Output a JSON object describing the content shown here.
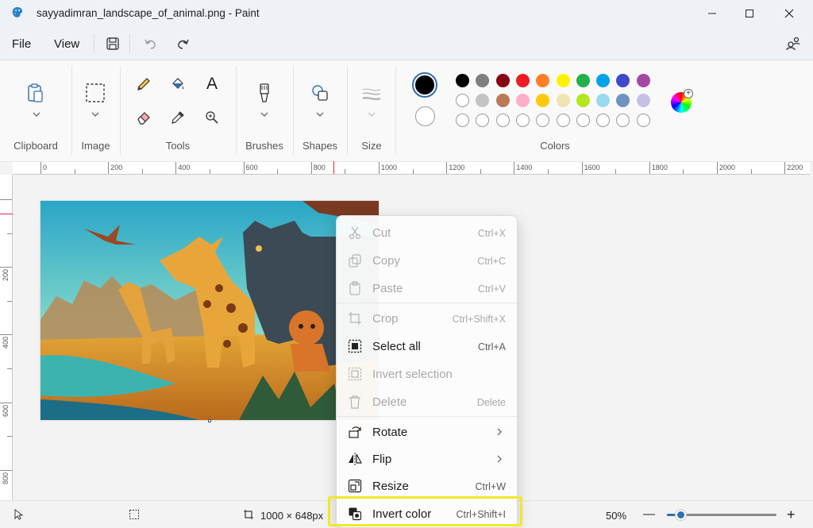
{
  "window": {
    "title": "sayyadimran_landscape_of_animal.png - Paint",
    "minimize_icon": "minimize-icon",
    "maximize_icon": "maximize-icon",
    "close_icon": "close-icon"
  },
  "menubar": {
    "file_label": "File",
    "view_label": "View",
    "save_icon": "save-icon",
    "undo_icon": "undo-icon",
    "redo_icon": "redo-icon",
    "account_icon": "account-icon"
  },
  "ribbon": {
    "clipboard_label": "Clipboard",
    "image_label": "Image",
    "tools_label": "Tools",
    "brushes_label": "Brushes",
    "shapes_label": "Shapes",
    "size_label": "Size",
    "colors_label": "Colors",
    "text_tool_glyph": "A",
    "primary_color": "#000000",
    "secondary_color": "#ffffff",
    "palette_row1": [
      "#000000",
      "#7f7f7f",
      "#880015",
      "#ed1c24",
      "#ff7f27",
      "#fff200",
      "#22b14c",
      "#00a2e8",
      "#3f48cc",
      "#a349a4"
    ],
    "palette_row2": [
      "#ffffff",
      "#c3c3c3",
      "#b97a57",
      "#ffaec9",
      "#ffc90e",
      "#efe4b0",
      "#b5e61d",
      "#99d9ea",
      "#7092be",
      "#c8bfe7"
    ]
  },
  "ruler": {
    "h_ticks": [
      "0",
      "200",
      "400",
      "600",
      "800",
      "1000",
      "1200",
      "1400",
      "1600",
      "1800",
      "2000",
      "2200"
    ],
    "v_ticks": [
      "200",
      "400",
      "600",
      "800"
    ]
  },
  "context_menu": {
    "items": [
      {
        "label": "Cut",
        "shortcut": "Ctrl+X",
        "icon": "scissors-icon",
        "enabled": false
      },
      {
        "label": "Copy",
        "shortcut": "Ctrl+C",
        "icon": "copy-icon",
        "enabled": false
      },
      {
        "label": "Paste",
        "shortcut": "Ctrl+V",
        "icon": "paste-icon",
        "enabled": false
      },
      {
        "label": "Crop",
        "shortcut": "Ctrl+Shift+X",
        "icon": "crop-icon",
        "enabled": false
      },
      {
        "label": "Select all",
        "shortcut": "Ctrl+A",
        "icon": "select-all-icon",
        "enabled": true
      },
      {
        "label": "Invert selection",
        "shortcut": "",
        "icon": "invert-selection-icon",
        "enabled": false
      },
      {
        "label": "Delete",
        "shortcut": "Delete",
        "icon": "trash-icon",
        "enabled": false
      },
      {
        "label": "Rotate",
        "shortcut": "",
        "icon": "rotate-icon",
        "enabled": true,
        "submenu": true
      },
      {
        "label": "Flip",
        "shortcut": "",
        "icon": "flip-icon",
        "enabled": true,
        "submenu": true
      },
      {
        "label": "Resize",
        "shortcut": "Ctrl+W",
        "icon": "resize-icon",
        "enabled": true
      },
      {
        "label": "Invert color",
        "shortcut": "Ctrl+Shift+I",
        "icon": "invert-color-icon",
        "enabled": true
      }
    ],
    "highlight_color": "#f2e829"
  },
  "statusbar": {
    "image_size": "1000 × 648px",
    "zoom": "50%",
    "zoom_out_glyph": "—",
    "zoom_in_glyph": "+",
    "zoom_level": 0.12
  }
}
